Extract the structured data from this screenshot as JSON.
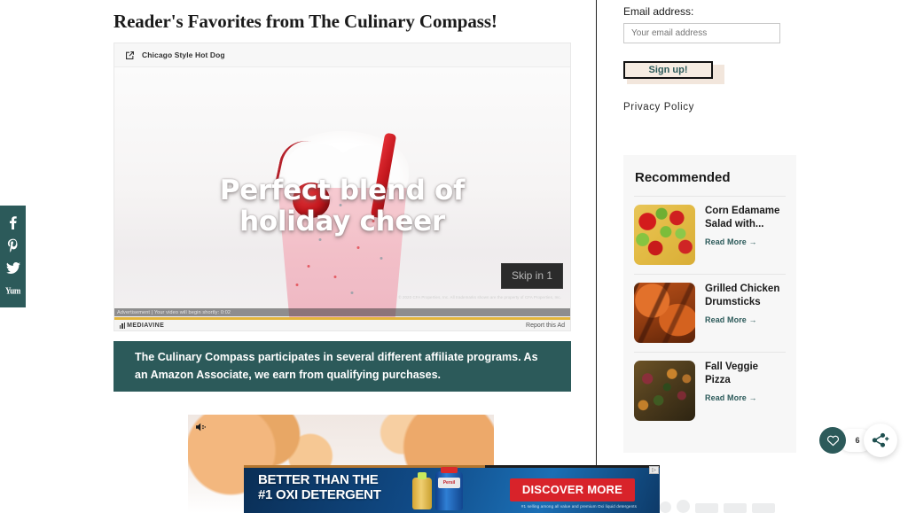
{
  "colors": {
    "brand_teal": "#2c5a5a",
    "accent_cream": "#f6ece2",
    "ad_red": "#d8232a",
    "progress_yellow": "#e3b53c"
  },
  "social_rail": {
    "items": [
      {
        "name": "facebook",
        "label": "Facebook"
      },
      {
        "name": "pinterest",
        "label": "Pinterest"
      },
      {
        "name": "twitter",
        "label": "Twitter"
      },
      {
        "name": "yummly",
        "label": "Yummly"
      }
    ],
    "yummly_text": "Yum"
  },
  "main": {
    "page_title": "Reader's Favorites from The Culinary Compass!",
    "affiliate_disclosure": "The Culinary Compass participates in several different affiliate programs. As an Amazon Associate, we earn from qualifying purchases."
  },
  "video_player": {
    "header_title": "Chicago Style Hot Dog",
    "overlay_caption_line1": "Perfect blend of",
    "overlay_caption_line2": "holiday cheer",
    "skip_label": "Skip in 1",
    "ad_status": "Advertisement | Your video will begin shortly: 0:02",
    "legal_text": "© 2020 CFA Properties, Inc. All trademarks shown are the property of CFA Properties, Inc.",
    "provider": "MEDIAVINE",
    "report_label": "Report this Ad"
  },
  "sidebar": {
    "email_label": "Email address:",
    "email_value": "",
    "email_placeholder": "Your email address",
    "signup_label": "Sign up!",
    "privacy_label": "Privacy Policy",
    "recommended": {
      "heading": "Recommended",
      "items": [
        {
          "title": "Corn Edamame Salad with...",
          "read_more": "Read More →",
          "thumb_class": "t-corn"
        },
        {
          "title": "Grilled Chicken Drumsticks",
          "read_more": "Read More →",
          "thumb_class": "t-chick"
        },
        {
          "title": "Fall Veggie Pizza",
          "read_more": "Read More →",
          "thumb_class": "t-pizza"
        }
      ]
    }
  },
  "float_share": {
    "count": "6"
  },
  "bottom_ad": {
    "headline_line1": "BETTER THAN THE",
    "headline_line2": "#1 OXI DETERGENT",
    "cta_label": "DISCOVER MORE",
    "fine_print": "#1 selling among all value and premium Oxi liquid detergents",
    "brand_label": "Persil",
    "choices_mark": "▷"
  }
}
